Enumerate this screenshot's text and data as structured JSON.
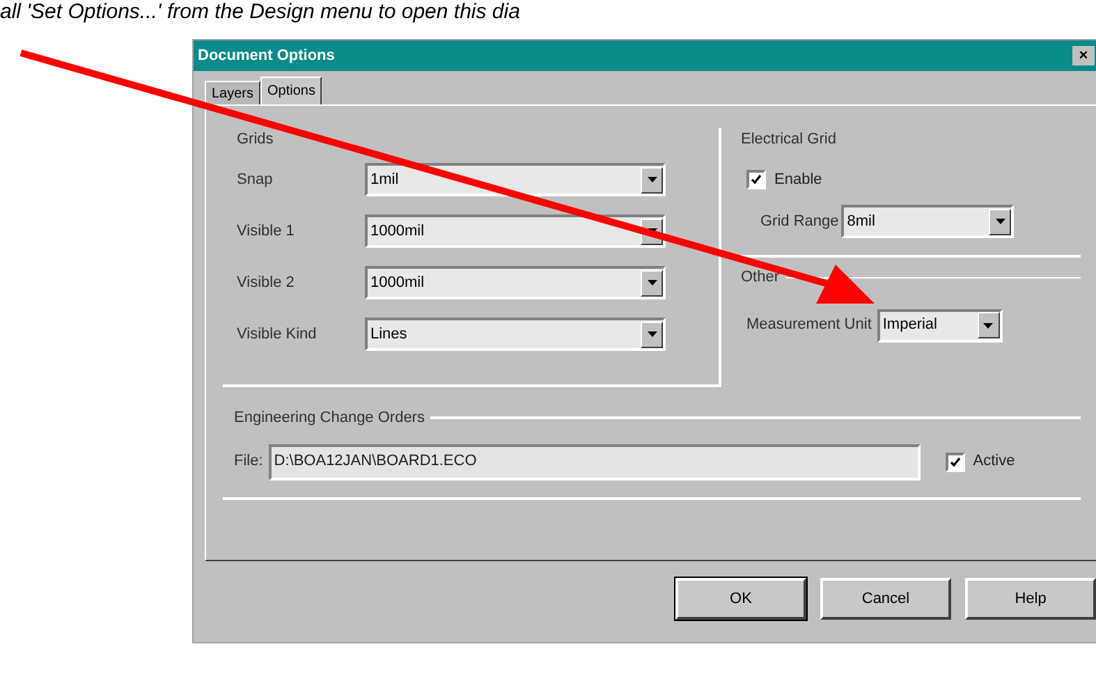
{
  "caption": "all 'Set Options...' from the Design menu to open this dia",
  "window": {
    "title": "Document Options",
    "close": "×"
  },
  "tabs": [
    {
      "label": "Layers",
      "selected": false
    },
    {
      "label": "Options",
      "selected": true
    }
  ],
  "grids": {
    "title": "Grids",
    "fields": [
      {
        "label": "Snap",
        "value": "1mil"
      },
      {
        "label": "Visible 1",
        "value": "1000mil"
      },
      {
        "label": "Visible 2",
        "value": "1000mil"
      },
      {
        "label": "Visible Kind",
        "value": "Lines"
      }
    ]
  },
  "electrical_grid": {
    "title": "Electrical Grid",
    "enable": {
      "label": "Enable",
      "checked": true
    },
    "grid_range": {
      "label": "Grid Range",
      "value": "8mil"
    }
  },
  "other": {
    "title": "Other",
    "measurement_unit": {
      "label": "Measurement Unit",
      "value": "Imperial"
    }
  },
  "eco": {
    "title": "Engineering Change Orders",
    "file_label": "File:",
    "file_value": "D:\\BOA12JAN\\BOARD1.ECO",
    "active": {
      "label": "Active",
      "checked": true
    }
  },
  "buttons": [
    {
      "label": "OK",
      "default": true
    },
    {
      "label": "Cancel",
      "default": false
    },
    {
      "label": "Help",
      "default": false
    }
  ]
}
